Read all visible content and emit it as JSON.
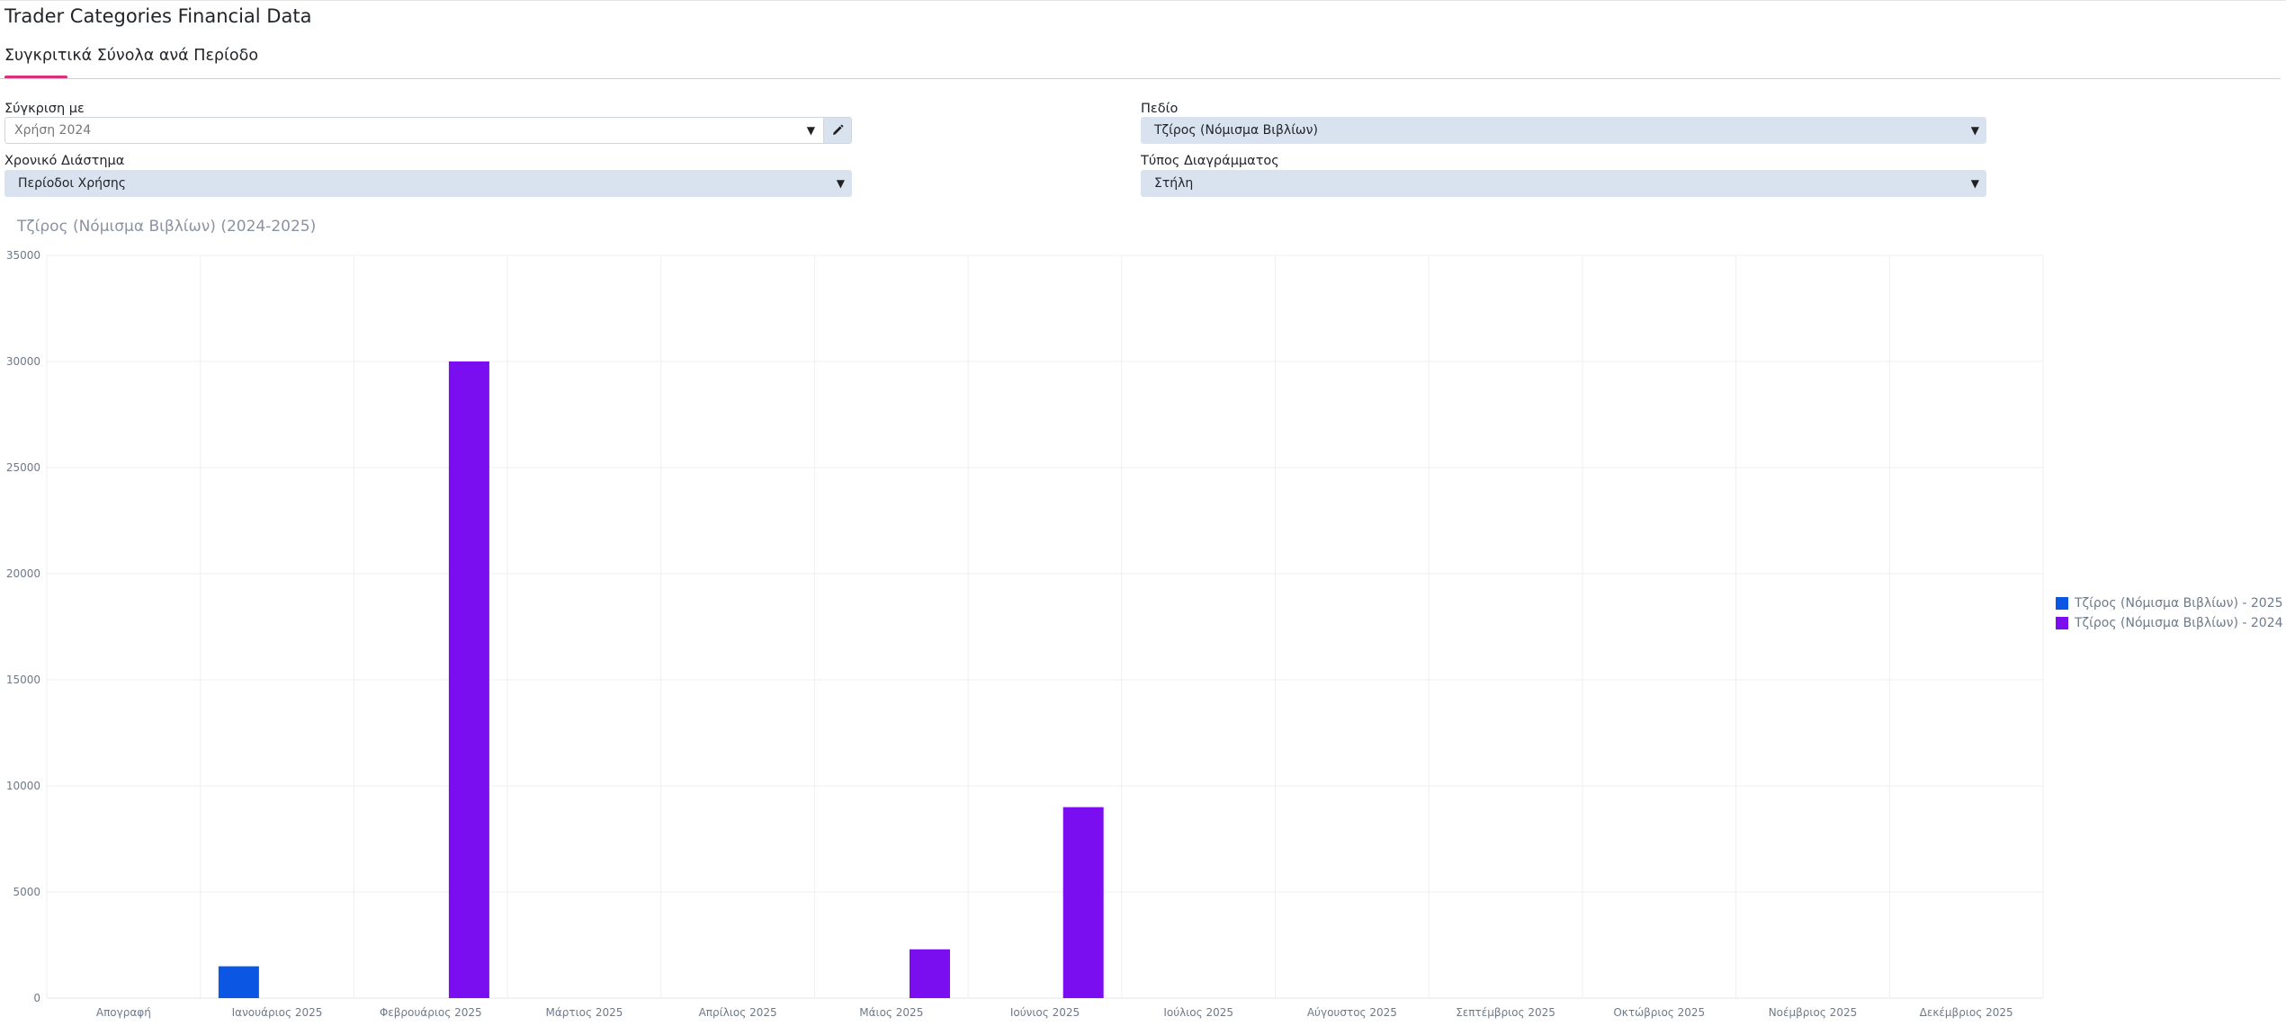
{
  "page": {
    "title": "Trader Categories Financial Data",
    "tab_title": "Συγκριτικά Σύνολα ανά Περίοδο"
  },
  "filters": {
    "compare_label": "Σύγκριση με",
    "compare_value": "Χρήση 2024",
    "field_label": "Πεδίο",
    "field_value": "Τζίρος (Νόμισμα Βιβλίων)",
    "range_label": "Χρονικό Διάστημα",
    "range_value": "Περίοδοι Χρήσης",
    "chart_type_label": "Τύπος Διαγράμματος",
    "chart_type_value": "Στήλη"
  },
  "icons": {
    "caret": "caret-down-icon",
    "edit": "pencil-icon"
  },
  "colors": {
    "accent": "#d6317a",
    "series_2025": "#0b57e3",
    "series_2024": "#7a0ef0"
  },
  "chart_data": {
    "type": "bar",
    "title": "Τζίρος (Νόμισμα Βιβλίων) (2024-2025)",
    "categories": [
      "Απογραφή",
      "Ιανουάριος 2025",
      "Φεβρουάριος 2025",
      "Μάρτιος 2025",
      "Απρίλιος 2025",
      "Μάιος 2025",
      "Ιούνιος 2025",
      "Ιούλιος 2025",
      "Αύγουστος 2025",
      "Σεπτέμβριος 2025",
      "Οκτώβριος 2025",
      "Νοέμβριος 2025",
      "Δεκέμβριος 2025"
    ],
    "series": [
      {
        "name": "Τζίρος (Νόμισμα Βιβλίων) - 2025",
        "color": "#0b57e3",
        "values": [
          0,
          1500,
          0,
          0,
          0,
          0,
          0,
          0,
          0,
          0,
          0,
          0,
          0
        ]
      },
      {
        "name": "Τζίρος (Νόμισμα Βιβλίων) - 2024",
        "color": "#7a0ef0",
        "values": [
          0,
          0,
          30000,
          0,
          0,
          2300,
          9000,
          0,
          0,
          0,
          0,
          0,
          0
        ]
      }
    ],
    "yticks": [
      "0",
      "5000",
      "10000",
      "15000",
      "20000",
      "25000",
      "30000",
      "35000"
    ],
    "ylim": [
      0,
      35000
    ],
    "grid": true,
    "legend_position": "right"
  }
}
